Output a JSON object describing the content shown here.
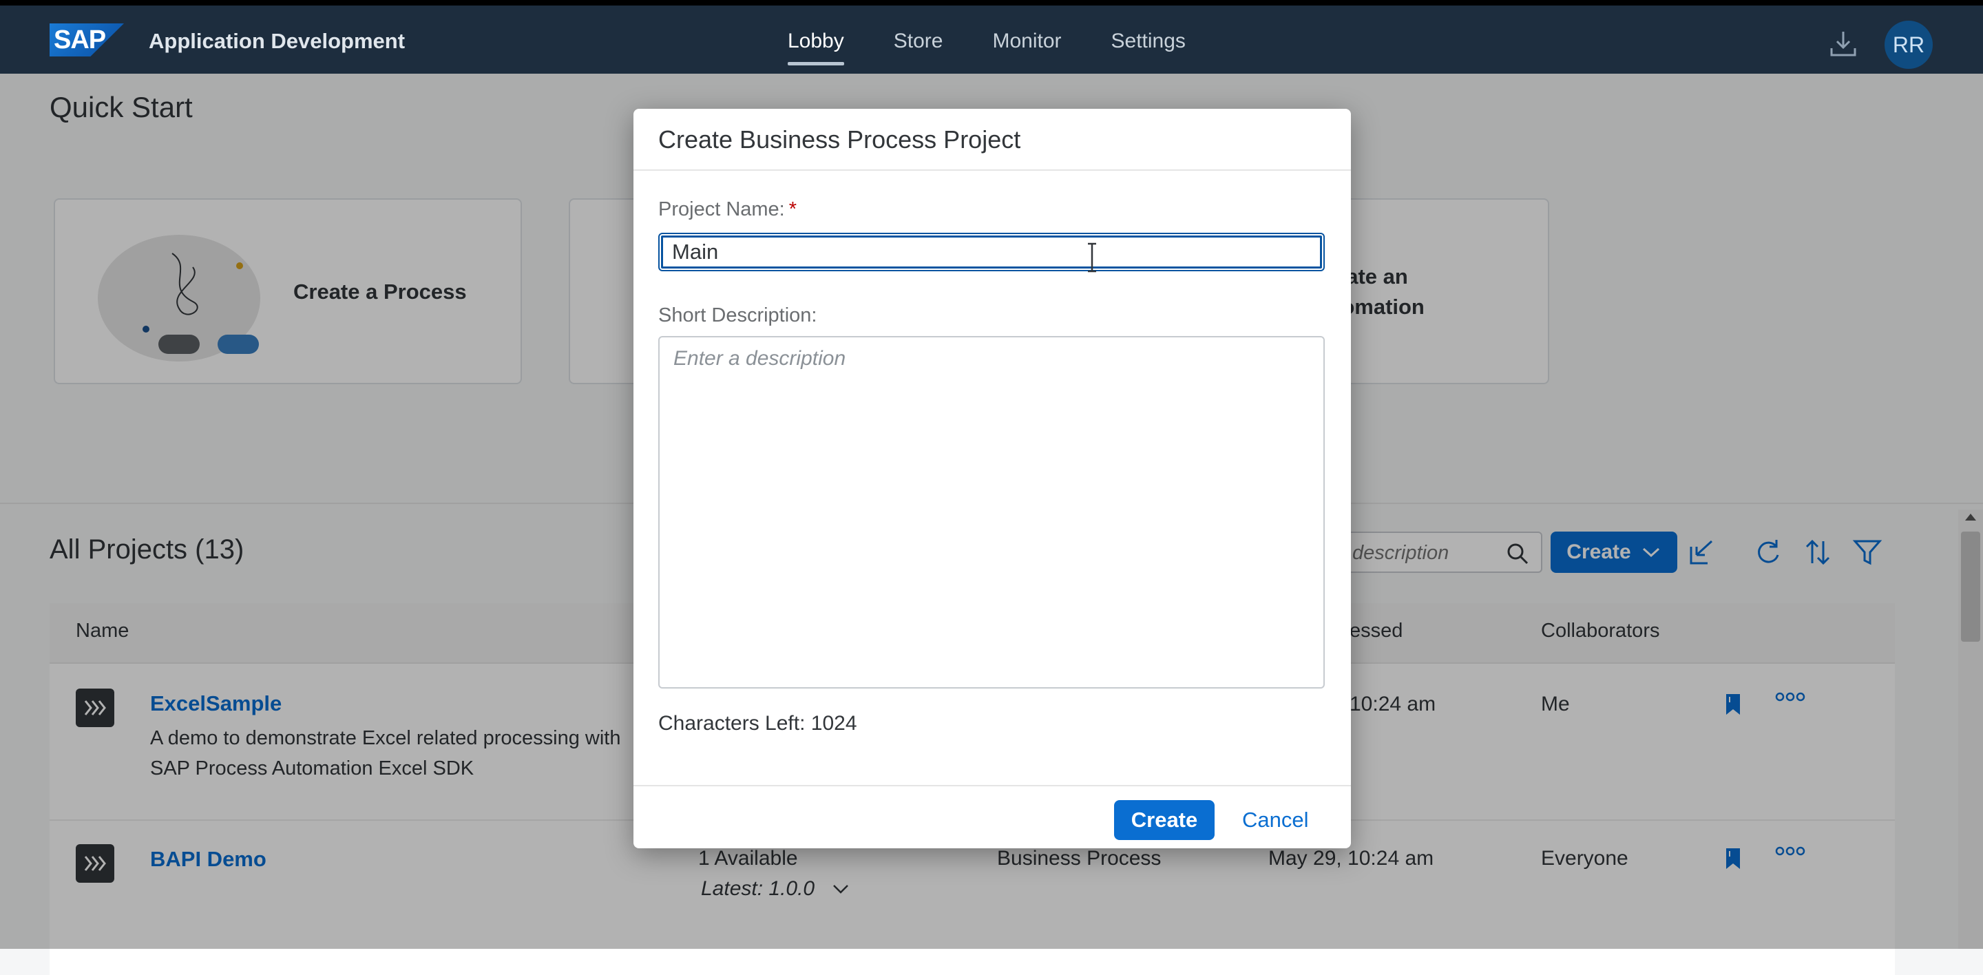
{
  "shell": {
    "logo_text": "SAP",
    "app_title": "Application Development",
    "nav": [
      {
        "label": "Lobby",
        "active": true
      },
      {
        "label": "Store",
        "active": false
      },
      {
        "label": "Monitor",
        "active": false
      },
      {
        "label": "Settings",
        "active": false
      }
    ],
    "avatar_initials": "RR",
    "icons": {
      "download": "download-icon"
    }
  },
  "quick_start": {
    "title": "Quick Start",
    "cards": [
      {
        "label": "Create a Process"
      },
      {
        "label": "eate an\ntomation"
      }
    ]
  },
  "projects": {
    "title": "All Projects (13)",
    "search_placeholder": "description",
    "create_label": "Create",
    "columns": [
      "Name",
      "essed",
      "Collaborators"
    ],
    "rows": [
      {
        "name": "ExcelSample",
        "description": "A demo to demonstrate Excel related processing with SAP Process Automation Excel SDK",
        "last_accessed": "10:24 am",
        "collaborators": "Me"
      },
      {
        "name": "BAPI Demo",
        "versions": "1 Available",
        "latest": "Latest: 1.0.0",
        "type": "Business Process",
        "last_accessed": "May 29, 10:24 am",
        "collaborators": "Everyone"
      }
    ]
  },
  "dialog": {
    "title": "Create Business Process Project",
    "name_label": "Project Name:",
    "required_mark": "*",
    "name_value": "Main",
    "desc_label": "Short Description:",
    "desc_placeholder": "Enter a description",
    "chars_left": "Characters Left: 1024",
    "create_label": "Create",
    "cancel_label": "Cancel"
  },
  "colors": {
    "shell_bg": "#1d2d3e",
    "accent": "#0a6ed1",
    "required": "#bb0000"
  }
}
